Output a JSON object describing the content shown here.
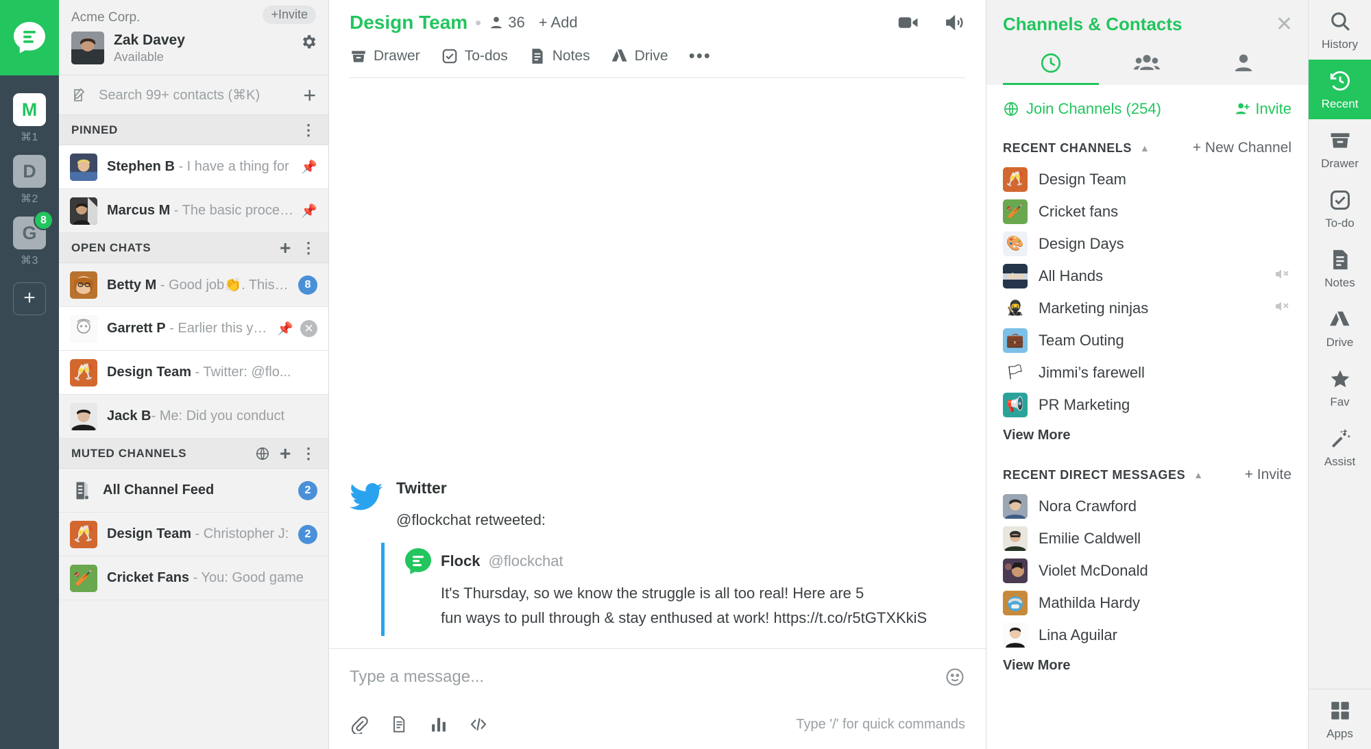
{
  "team_rail": {
    "logo_name": "flock-logo",
    "teams": [
      {
        "letter": "M",
        "shortcut": "⌘1",
        "active": true,
        "badge": null
      },
      {
        "letter": "D",
        "shortcut": "⌘2",
        "active": false,
        "badge": null
      },
      {
        "letter": "G",
        "shortcut": "⌘3",
        "active": false,
        "badge": "8"
      }
    ],
    "add_team_label": "+"
  },
  "sidebar": {
    "org_name": "Acme Corp.",
    "invite_button": "+Invite",
    "user_name": "Zak Davey",
    "user_status": "Available",
    "settings_icon": "gear-icon",
    "search_placeholder": "Search 99+ contacts (⌘K)",
    "add_button": "+",
    "sections": [
      {
        "title": "PINNED",
        "actions": [
          "kebab-icon"
        ],
        "rows": [
          {
            "name": "Stephen B",
            "preview": " - I have a thing for",
            "pinned": true,
            "badge": null,
            "avatar": "photo-stephen"
          },
          {
            "name": "Marcus M",
            "preview": " - The basic proced...",
            "pinned": true,
            "badge": null,
            "avatar": "photo-marcus"
          }
        ]
      },
      {
        "title": "OPEN CHATS",
        "actions": [
          "plus-icon",
          "kebab-icon"
        ],
        "rows": [
          {
            "name": "Betty M",
            "preview": " - Good job👏. This h...",
            "pinned": false,
            "badge": "8",
            "avatar": "photo-betty"
          },
          {
            "name": "Garrett P",
            "preview": " - Earlier this year...",
            "pinned": true,
            "closable": true,
            "badge": null,
            "avatar": "photo-garrett"
          },
          {
            "name": "Design Team",
            "preview": " - Twitter: @flo...",
            "pinned": false,
            "badge": null,
            "avatar": "emoji-design-team"
          },
          {
            "name": "Jack B",
            "preview": "- Me: Did you conduct",
            "pinned": false,
            "badge": null,
            "avatar": "photo-jack"
          }
        ]
      },
      {
        "title": "MUTED CHANNELS",
        "actions": [
          "globe-icon",
          "plus-icon",
          "kebab-icon"
        ],
        "rows": [
          {
            "name": "All Channel Feed",
            "preview": "",
            "pinned": false,
            "badge": "2",
            "avatar": "feed-icon"
          },
          {
            "name": "Design Team",
            "preview": " - Christopher J:",
            "pinned": false,
            "badge": "2",
            "avatar": "emoji-design-team"
          },
          {
            "name": "Cricket Fans",
            "preview": " - You: Good game",
            "pinned": false,
            "badge": null,
            "avatar": "emoji-cricket"
          }
        ]
      }
    ]
  },
  "chat": {
    "title": "Design Team",
    "member_count": "36",
    "add_label": "+ Add",
    "video_icon": "video-camera-icon",
    "speaker_icon": "speaker-icon",
    "tools": [
      {
        "label": "Drawer",
        "icon": "drawer-icon"
      },
      {
        "label": "To-dos",
        "icon": "checkbox-icon"
      },
      {
        "label": "Notes",
        "icon": "note-icon"
      },
      {
        "label": "Drive",
        "icon": "drive-icon"
      },
      {
        "label": "•••",
        "icon": "more-icon"
      }
    ],
    "message": {
      "source": "Twitter",
      "source_icon": "twitter-bird-icon",
      "action_text": "@flockchat retweeted:",
      "quote": {
        "author": "Flock",
        "handle": "@flockchat",
        "avatar": "flock-avatar",
        "line1": "It's Thursday, so we know the struggle is all too real! Here are 5",
        "line2": "fun ways to pull through & stay enthused at work! https://t.co/r5tGTXKkiS"
      }
    },
    "composer": {
      "placeholder": "Type a message...",
      "emoji_icon": "emoji-smiley-icon",
      "attach_icon": "paperclip-icon",
      "doc_icon": "document-icon",
      "poll_icon": "poll-bars-icon",
      "code_icon": "code-snippet-icon",
      "hint": "Type '/' for quick commands"
    }
  },
  "right_panel": {
    "title": "Channels & Contacts",
    "close_icon": "close-icon",
    "tabs": [
      {
        "icon": "clock-icon",
        "active": true
      },
      {
        "icon": "group-people-icon",
        "active": false
      },
      {
        "icon": "person-icon",
        "active": false
      }
    ],
    "join_channels": "Join Channels (254)",
    "join_icon": "globe-icon",
    "invite": "Invite",
    "invite_icon": "person-add-icon",
    "channels_section": {
      "title": "RECENT CHANNELS",
      "action": "+ New Channel",
      "items": [
        {
          "label": "Design Team",
          "muted": false,
          "avatar": "emoji-design-team"
        },
        {
          "label": "Cricket fans",
          "muted": false,
          "avatar": "emoji-cricket"
        },
        {
          "label": "Design Days",
          "muted": false,
          "avatar": "emoji-palette"
        },
        {
          "label": "All Hands",
          "muted": true,
          "avatar": "photo-hands"
        },
        {
          "label": "Marketing ninjas",
          "muted": true,
          "avatar": "emoji-ninja"
        },
        {
          "label": "Team Outing",
          "muted": false,
          "avatar": "emoji-suitcase"
        },
        {
          "label": "Jimmi’s farewell",
          "muted": false,
          "avatar": "emoji-flag"
        },
        {
          "label": "PR Marketing",
          "muted": false,
          "avatar": "emoji-megaphone"
        }
      ],
      "view_more": "View More"
    },
    "dm_section": {
      "title": "RECENT DIRECT MESSAGES",
      "action": "+ Invite",
      "items": [
        {
          "label": "Nora Crawford",
          "avatar": "photo-nora"
        },
        {
          "label": "Emilie Caldwell",
          "avatar": "photo-emilie"
        },
        {
          "label": "Violet McDonald",
          "avatar": "photo-violet"
        },
        {
          "label": "Mathilda Hardy",
          "avatar": "photo-mathilda"
        },
        {
          "label": "Lina Aguilar",
          "avatar": "photo-lina"
        }
      ],
      "view_more": "View More"
    }
  },
  "far_rail": {
    "items": [
      {
        "label": "History",
        "icon": "search-icon",
        "active": false
      },
      {
        "label": "Recent",
        "icon": "history-clock-icon",
        "active": true
      },
      {
        "label": "Drawer",
        "icon": "drawer-icon",
        "active": false
      },
      {
        "label": "To-do",
        "icon": "checkbox-icon",
        "active": false
      },
      {
        "label": "Notes",
        "icon": "note-icon",
        "active": false
      },
      {
        "label": "Drive",
        "icon": "drive-icon",
        "active": false
      },
      {
        "label": "Fav",
        "icon": "star-icon",
        "active": false
      },
      {
        "label": "Assist",
        "icon": "magic-wand-icon",
        "active": false
      }
    ],
    "apps": {
      "label": "Apps",
      "icon": "grid-apps-icon"
    }
  },
  "colors": {
    "brand_green": "#22c55e",
    "rail_dark": "#384953",
    "badge_blue": "#4a90d9",
    "twitter_blue": "#2aa3ef"
  }
}
